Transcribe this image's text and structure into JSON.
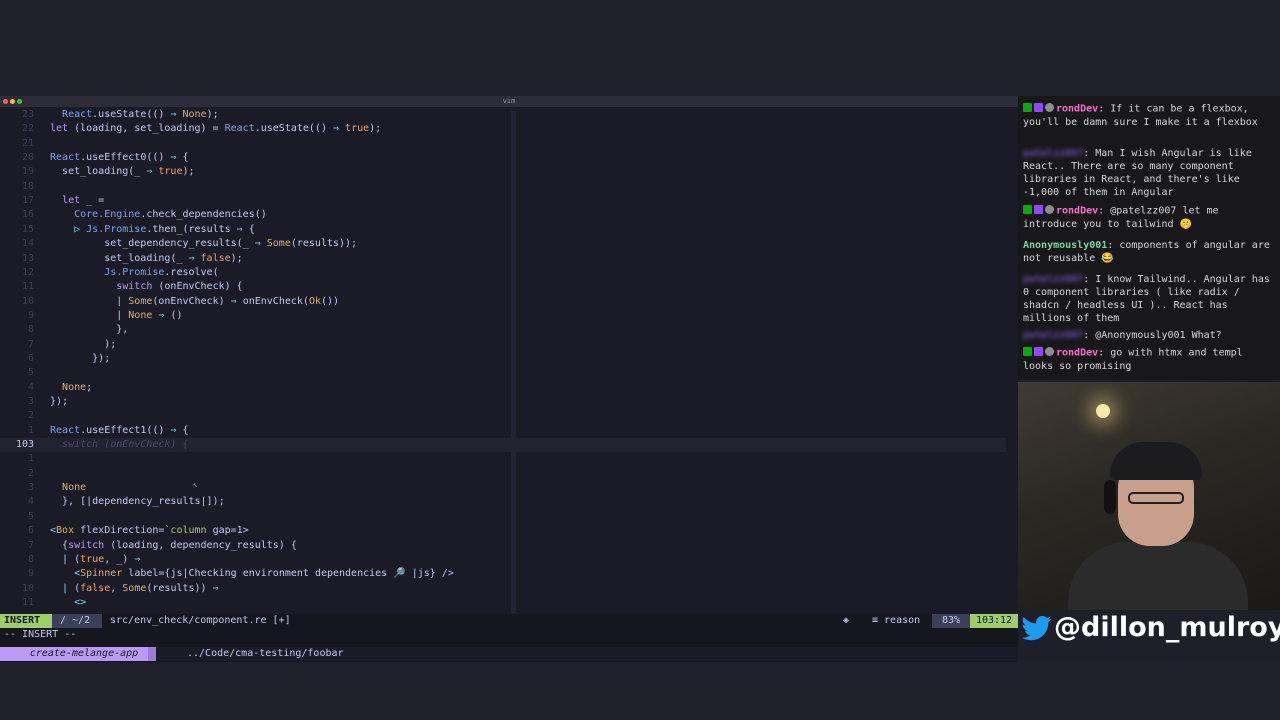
{
  "window": {
    "title": "vim"
  },
  "editor": {
    "lines": [
      {
        "n": "23",
        "current": false,
        "indent": "  ",
        "segs": [
          [
            "mod",
            "React"
          ],
          [
            "fn",
            ".useState(() "
          ],
          [
            "pn",
            "⇒"
          ],
          [
            "ctor",
            " None"
          ],
          [
            "fn",
            ");"
          ]
        ]
      },
      {
        "n": "22",
        "current": false,
        "indent": "",
        "segs": [
          [
            "kw",
            "let"
          ],
          [
            "fn",
            " (loading, set_loading) = "
          ],
          [
            "mod",
            "React"
          ],
          [
            "fn",
            ".useState(() "
          ],
          [
            "pn",
            "⇒"
          ],
          [
            "lit",
            " true"
          ],
          [
            "fn",
            ");"
          ]
        ]
      },
      {
        "n": "21",
        "current": false,
        "indent": "",
        "segs": []
      },
      {
        "n": "20",
        "current": false,
        "indent": "",
        "segs": [
          [
            "mod",
            "React"
          ],
          [
            "fn",
            ".useEffect0(() "
          ],
          [
            "pn",
            "⇒"
          ],
          [
            "fn",
            " {"
          ]
        ]
      },
      {
        "n": "19",
        "current": false,
        "indent": "  ",
        "segs": [
          [
            "fn",
            "set_loading(_ "
          ],
          [
            "pn",
            "⇒"
          ],
          [
            "lit",
            " true"
          ],
          [
            "fn",
            ");"
          ]
        ]
      },
      {
        "n": "18",
        "current": false,
        "indent": "",
        "segs": []
      },
      {
        "n": "17",
        "current": false,
        "indent": "  ",
        "segs": [
          [
            "kw",
            "let"
          ],
          [
            "fn",
            " _ ="
          ]
        ]
      },
      {
        "n": "16",
        "current": false,
        "indent": "    ",
        "segs": [
          [
            "mod",
            "Core.Engine"
          ],
          [
            "fn",
            ".check_dependencies()"
          ]
        ]
      },
      {
        "n": "15",
        "current": false,
        "indent": "    ",
        "segs": [
          [
            "pn",
            "▷ "
          ],
          [
            "mod",
            "Js.Promise"
          ],
          [
            "fn",
            ".then_(results "
          ],
          [
            "pn",
            "⇒"
          ],
          [
            "fn",
            " {"
          ]
        ]
      },
      {
        "n": "14",
        "current": false,
        "indent": "         ",
        "segs": [
          [
            "fn",
            "set_dependency_results(_ "
          ],
          [
            "pn",
            "⇒"
          ],
          [
            "ctor",
            " Some"
          ],
          [
            "fn",
            "(results));"
          ]
        ]
      },
      {
        "n": "13",
        "current": false,
        "indent": "         ",
        "segs": [
          [
            "fn",
            "set_loading(_ "
          ],
          [
            "pn",
            "⇒"
          ],
          [
            "lit",
            " false"
          ],
          [
            "fn",
            ");"
          ]
        ]
      },
      {
        "n": "12",
        "current": false,
        "indent": "         ",
        "segs": [
          [
            "mod",
            "Js.Promise"
          ],
          [
            "fn",
            ".resolve("
          ]
        ]
      },
      {
        "n": "11",
        "current": false,
        "indent": "           ",
        "segs": [
          [
            "kw",
            "switch"
          ],
          [
            "fn",
            " (onEnvCheck) {"
          ]
        ]
      },
      {
        "n": "10",
        "current": false,
        "indent": "           ",
        "segs": [
          [
            "pn",
            "| "
          ],
          [
            "ctor",
            "Some"
          ],
          [
            "fn",
            "(onEnvCheck) "
          ],
          [
            "pn",
            "⇒"
          ],
          [
            "fn",
            " onEnvCheck("
          ],
          [
            "ctor",
            "Ok"
          ],
          [
            "fn",
            "())"
          ]
        ]
      },
      {
        "n": "9",
        "current": false,
        "indent": "           ",
        "segs": [
          [
            "pn",
            "| "
          ],
          [
            "ctor",
            "None"
          ],
          [
            "pn",
            " ⇒"
          ],
          [
            "fn",
            " ()"
          ]
        ]
      },
      {
        "n": "8",
        "current": false,
        "indent": "           ",
        "segs": [
          [
            "fn",
            "},"
          ]
        ]
      },
      {
        "n": "7",
        "current": false,
        "indent": "         ",
        "segs": [
          [
            "fn",
            ");"
          ]
        ]
      },
      {
        "n": "6",
        "current": false,
        "indent": "       ",
        "segs": [
          [
            "fn",
            "});"
          ]
        ]
      },
      {
        "n": "5",
        "current": false,
        "indent": "",
        "segs": []
      },
      {
        "n": "4",
        "current": false,
        "indent": "  ",
        "segs": [
          [
            "ctor",
            "None"
          ],
          [
            "fn",
            ";"
          ]
        ]
      },
      {
        "n": "3",
        "current": false,
        "indent": "",
        "segs": [
          [
            "fn",
            "});"
          ]
        ]
      },
      {
        "n": "2",
        "current": false,
        "indent": "",
        "segs": []
      },
      {
        "n": "1",
        "current": false,
        "indent": "",
        "segs": [
          [
            "mod",
            "React"
          ],
          [
            "fn",
            ".useEffect1(() "
          ],
          [
            "pn",
            "⇒"
          ],
          [
            "fn",
            " {"
          ]
        ]
      },
      {
        "n": "103",
        "current": true,
        "indent": "  ",
        "segs": [
          [
            "dim",
            "switch (onEnvCheck) {"
          ]
        ]
      },
      {
        "n": "1",
        "current": false,
        "indent": "",
        "segs": []
      },
      {
        "n": "2",
        "current": false,
        "indent": "",
        "segs": []
      },
      {
        "n": "3",
        "current": false,
        "indent": "  ",
        "segs": [
          [
            "ctor",
            "None"
          ]
        ]
      },
      {
        "n": "4",
        "current": false,
        "indent": "  ",
        "segs": [
          [
            "fn",
            "}, [|dependency_results|]);"
          ]
        ]
      },
      {
        "n": "5",
        "current": false,
        "indent": "",
        "segs": []
      },
      {
        "n": "6",
        "current": false,
        "indent": "",
        "segs": [
          [
            "pn",
            "<"
          ],
          [
            "ctor",
            "Box"
          ],
          [
            "fn",
            " flexDirection="
          ],
          [
            "str",
            "`column"
          ],
          [
            "fn",
            " gap=1>"
          ]
        ]
      },
      {
        "n": "7",
        "current": false,
        "indent": "  ",
        "segs": [
          [
            "fn",
            "{"
          ],
          [
            "kw",
            "switch"
          ],
          [
            "fn",
            " (loading, dependency_results) {"
          ]
        ]
      },
      {
        "n": "8",
        "current": false,
        "indent": "  ",
        "segs": [
          [
            "pn",
            "| "
          ],
          [
            "fn",
            "("
          ],
          [
            "lit",
            "true"
          ],
          [
            "fn",
            ", _) "
          ],
          [
            "pn",
            "⇒"
          ]
        ]
      },
      {
        "n": "9",
        "current": false,
        "indent": "    ",
        "segs": [
          [
            "pn",
            "<"
          ],
          [
            "ctor",
            "Spinner"
          ],
          [
            "fn",
            " label={js|Checking environment dependencies "
          ],
          [
            "pn",
            "🔎"
          ],
          [
            "fn",
            " |js} />"
          ]
        ]
      },
      {
        "n": "10",
        "current": false,
        "indent": "  ",
        "segs": [
          [
            "pn",
            "| "
          ],
          [
            "fn",
            "("
          ],
          [
            "lit",
            "false"
          ],
          [
            "fn",
            ", "
          ],
          [
            "ctor",
            "Some"
          ],
          [
            "fn",
            "(results)) "
          ],
          [
            "pn",
            "⇒"
          ]
        ]
      },
      {
        "n": "11",
        "current": false,
        "indent": "    ",
        "segs": [
          [
            "pn",
            "<>"
          ]
        ]
      }
    ]
  },
  "statusline": {
    "mode": "INSERT",
    "branch": "/ ~/2",
    "file": "src/env_check/component.re [+]",
    "icon": "layers-icon",
    "filetype": "≡ reason",
    "percent": "83%",
    "position": "103:12"
  },
  "cmdline": "-- INSERT --",
  "tmux": {
    "session": "create-melange-app",
    "path": "../Code/cma-testing/foobar"
  },
  "chat": {
    "colors": {
      "rondDev": "#ff6bd1",
      "anonymous": "#7fd1a5",
      "mod": "#8f6bff"
    },
    "messages": [
      {
        "user": "rondDev",
        "badges": true,
        "blurred": false,
        "text": "If it can be a flexbox, you'll be damn sure I make it a flexbox"
      },
      {
        "user": "patelzz007",
        "badges": false,
        "blurred": true,
        "text": "Man I wish Angular is like React.. There are so many component libraries in React, and there's like -1,000 of them in Angular"
      },
      {
        "user": "rondDev",
        "badges": true,
        "blurred": false,
        "text": "@patelzz007 let me introduce you to tailwind 🤫"
      },
      {
        "user": "Anonymously001",
        "badges": false,
        "blurred": false,
        "text": "components of angular are not reusable 😂"
      },
      {
        "user": "patelzz007",
        "badges": false,
        "blurred": true,
        "text": "I know Tailwind.. Angular has 0 component libraries ( like radix / shadcn / headless UI ).. React has millions of them"
      },
      {
        "user": "patelzz007",
        "badges": false,
        "blurred": true,
        "text": "@Anonymously001 What?"
      },
      {
        "user": "rondDev",
        "badges": true,
        "blurred": false,
        "text": "go with htmx and templ looks so promising"
      }
    ]
  },
  "overlay": {
    "handle": "@dillon_mulroy",
    "icon": "twitter-bird-icon"
  }
}
